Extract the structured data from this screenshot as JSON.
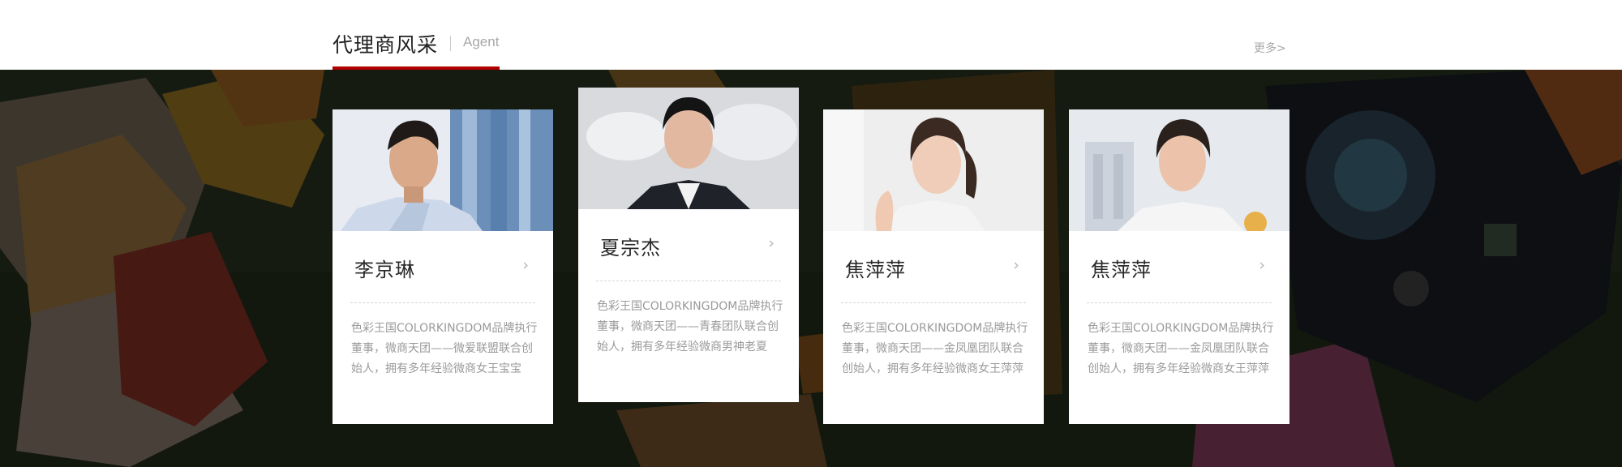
{
  "section": {
    "title": "代理商风采",
    "subtitle": "Agent",
    "more_label": "更多>"
  },
  "colors": {
    "accent": "#b00000",
    "card_bg": "#ffffff",
    "background_overlay": "#1d231b"
  },
  "agents": [
    {
      "name": "李京琳",
      "chevron": "›",
      "description": "色彩王国COLORKINGDOM品牌执行董事，微商天团——微爱联盟联合创始人，拥有多年经验微商女王宝宝"
    },
    {
      "name": "夏宗杰",
      "chevron": "›",
      "description": "色彩王国COLORKINGDOM品牌执行董事，微商天团——青春团队联合创始人，拥有多年经验微商男神老夏"
    },
    {
      "name": "焦萍萍",
      "chevron": "›",
      "description": "色彩王国COLORKINGDOM品牌执行董事，微商天团——金凤凰团队联合创始人，拥有多年经验微商女王萍萍"
    },
    {
      "name": "焦萍萍",
      "chevron": "›",
      "description": "色彩王国COLORKINGDOM品牌执行董事，微商天团——金凤凰团队联合创始人，拥有多年经验微商女王萍萍"
    }
  ]
}
